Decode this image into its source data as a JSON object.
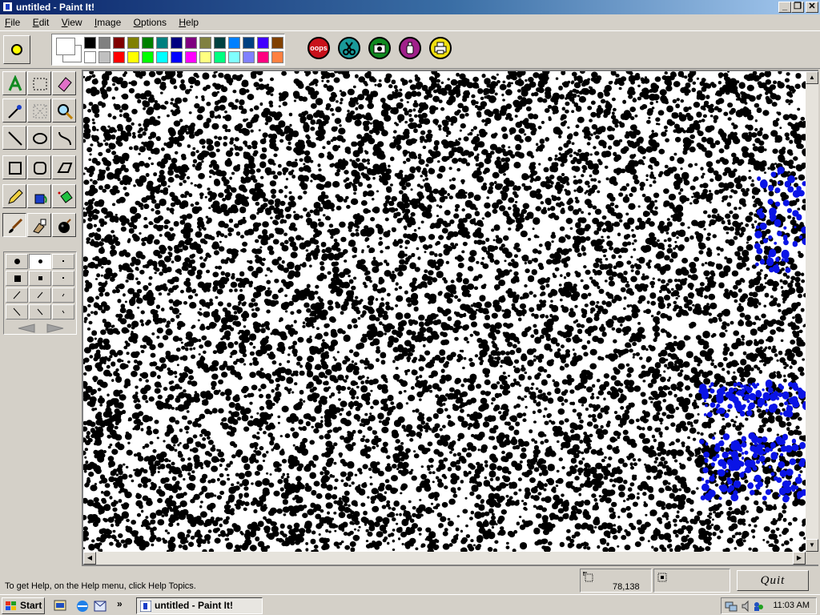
{
  "window": {
    "title": "untitled - Paint It!"
  },
  "titlebar_buttons": [
    {
      "name": "minimize-button",
      "glyph": "_"
    },
    {
      "name": "restore-button",
      "glyph": "❐"
    },
    {
      "name": "close-button",
      "glyph": "✕"
    }
  ],
  "menu": [
    {
      "label": "File",
      "key": "F",
      "rest": "ile"
    },
    {
      "label": "Edit",
      "key": "E",
      "rest": "dit"
    },
    {
      "label": "View",
      "key": "V",
      "rest": "iew"
    },
    {
      "label": "Image",
      "key": "I",
      "rest": "mage"
    },
    {
      "label": "Options",
      "key": "O",
      "rest": "ptions"
    },
    {
      "label": "Help",
      "key": "H",
      "rest": "elp"
    }
  ],
  "palette": {
    "row1": [
      "#000000",
      "#808080",
      "#800000",
      "#808000",
      "#008000",
      "#008080",
      "#000080",
      "#800080",
      "#808040",
      "#004040",
      "#0080ff",
      "#004080",
      "#4000ff",
      "#804000"
    ],
    "row2": [
      "#ffffff",
      "#c0c0c0",
      "#ff0000",
      "#ffff00",
      "#00ff00",
      "#00ffff",
      "#0000ff",
      "#ff00ff",
      "#ffff80",
      "#00ff80",
      "#80ffff",
      "#8080ff",
      "#ff0080",
      "#ff8040"
    ],
    "foreground": "#ffffff",
    "background": "#ffffff"
  },
  "action_buttons": [
    {
      "name": "oops-button",
      "label": "oops",
      "color": "#c8101a"
    },
    {
      "name": "scissors-button",
      "label": "",
      "color": "#1a9a9a"
    },
    {
      "name": "camera-button",
      "label": "",
      "color": "#108a20"
    },
    {
      "name": "bottle-button",
      "label": "",
      "color": "#a0208a"
    },
    {
      "name": "printer-button",
      "label": "",
      "color": "#f0e010"
    }
  ],
  "tools": [
    "text-tool",
    "select-rectangle-tool",
    "eraser-tool",
    "eyedropper-tool",
    "select-freeform-tool",
    "magnifier-tool",
    "line-tool",
    "ellipse-tool",
    "curve-tool",
    "rectangle-tool",
    "rounded-rectangle-tool",
    "polygon-tool",
    "pencil-tool",
    "paint-bucket-tool",
    "spray-tool",
    "brush-tool",
    "airbrush-tool",
    "bomb-tool"
  ],
  "active_tool": "brush-tool",
  "status": {
    "help_text": "To get Help, on the Help menu, click Help Topics.",
    "coordinates": "78,138",
    "quit_label": "Quit"
  },
  "taskbar": {
    "start_label": "Start",
    "task_label": "untitled - Paint It!",
    "clock": "11:03 AM",
    "chevron": "»"
  },
  "colors": {
    "titlebar_start": "#0a246a",
    "canvas_ink": "#000000",
    "canvas_paper": "#ffffff",
    "accent_blue": "#0a14e6"
  }
}
